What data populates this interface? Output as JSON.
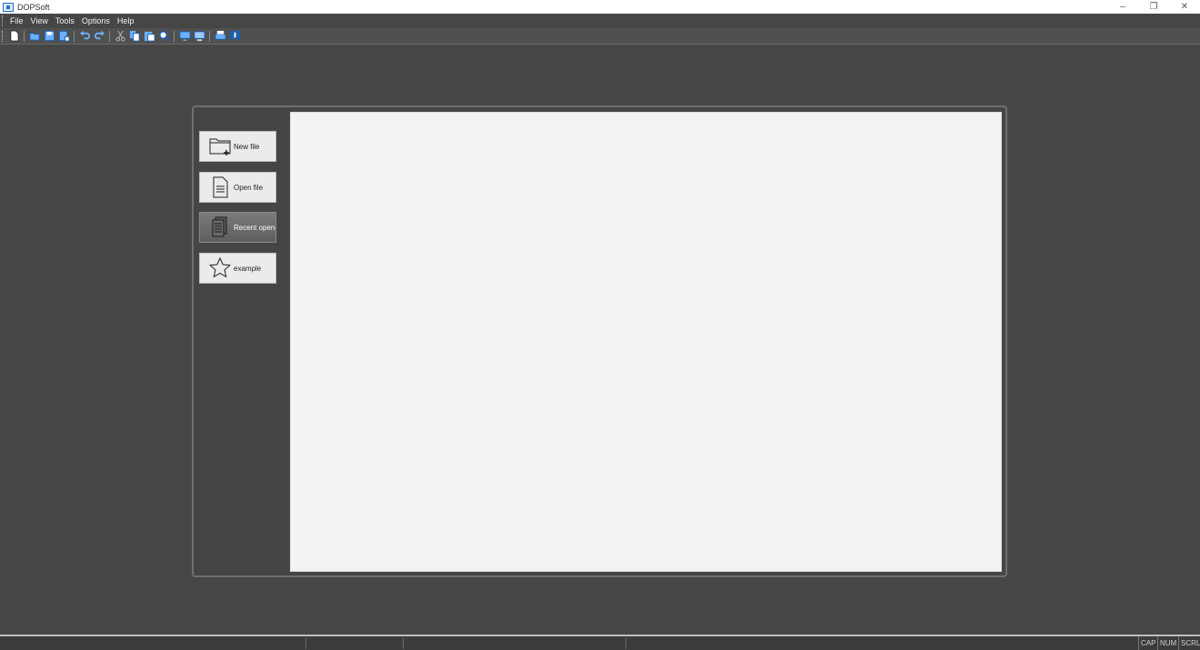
{
  "window": {
    "title": "DOPSoft",
    "minimize_glyph": "–",
    "maximize_glyph": "❐",
    "close_glyph": "✕"
  },
  "menu": {
    "items": [
      {
        "label": "File"
      },
      {
        "label": "View"
      },
      {
        "label": "Tools"
      },
      {
        "label": "Options"
      },
      {
        "label": "Help"
      }
    ]
  },
  "toolbar": {
    "buttons": [
      "new-icon",
      "open-icon",
      "save-icon",
      "save-as-icon",
      "undo-icon",
      "redo-icon",
      "cut-icon",
      "copy-icon",
      "paste-icon",
      "find-icon",
      "screen-icon",
      "download-icon",
      "print-icon",
      "info-icon"
    ]
  },
  "start_panel": {
    "buttons": [
      {
        "label": "New file",
        "icon": "new-folder-icon"
      },
      {
        "label": "Open file",
        "icon": "open-file-icon"
      },
      {
        "label": "Recent opened",
        "icon": "recent-files-icon",
        "active": true
      },
      {
        "label": "example",
        "icon": "star-icon"
      }
    ]
  },
  "status": {
    "cap": "CAP",
    "num": "NUM",
    "scrl": "SCRL"
  },
  "colors": {
    "background": "#464646",
    "preview": "#f3f3f3",
    "button": "#ebebeb",
    "active_button": "#6b6b6b"
  }
}
